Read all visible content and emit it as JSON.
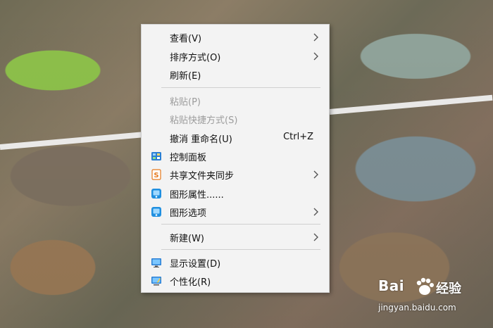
{
  "desktop": {
    "description": ""
  },
  "context_menu": {
    "items": [
      {
        "label": "查看(V)",
        "enabled": true,
        "has_submenu": true,
        "icon": null
      },
      {
        "label": "排序方式(O)",
        "enabled": true,
        "has_submenu": true,
        "icon": null
      },
      {
        "label": "刷新(E)",
        "enabled": true,
        "has_submenu": false,
        "icon": null
      },
      {
        "label": "粘贴(P)",
        "enabled": false,
        "has_submenu": false,
        "icon": null
      },
      {
        "label": "粘贴快捷方式(S)",
        "enabled": false,
        "has_submenu": false,
        "icon": null
      },
      {
        "label": "撤消 重命名(U)",
        "enabled": true,
        "has_submenu": false,
        "shortcut": "Ctrl+Z",
        "icon": null
      },
      {
        "label": "控制面板",
        "enabled": true,
        "has_submenu": false,
        "icon": "control-panel-icon"
      },
      {
        "label": "共享文件夹同步",
        "enabled": true,
        "has_submenu": true,
        "icon": "share-sync-icon"
      },
      {
        "label": "图形属性......",
        "enabled": true,
        "has_submenu": false,
        "icon": "graphics-properties-icon"
      },
      {
        "label": "图形选项",
        "enabled": true,
        "has_submenu": true,
        "icon": "graphics-options-icon"
      },
      {
        "label": "新建(W)",
        "enabled": true,
        "has_submenu": true,
        "icon": null
      },
      {
        "label": "显示设置(D)",
        "enabled": true,
        "has_submenu": false,
        "icon": "display-settings-icon"
      },
      {
        "label": "个性化(R)",
        "enabled": true,
        "has_submenu": false,
        "icon": "personalize-icon"
      }
    ]
  },
  "watermark": {
    "brand": "Bai",
    "brand_suffix": "经验",
    "url": "jingyan.baidu.com"
  },
  "colors": {
    "menu_bg": "#f3f3f3",
    "disabled_text": "#9c9c9c",
    "separator": "#cfcfcf"
  }
}
